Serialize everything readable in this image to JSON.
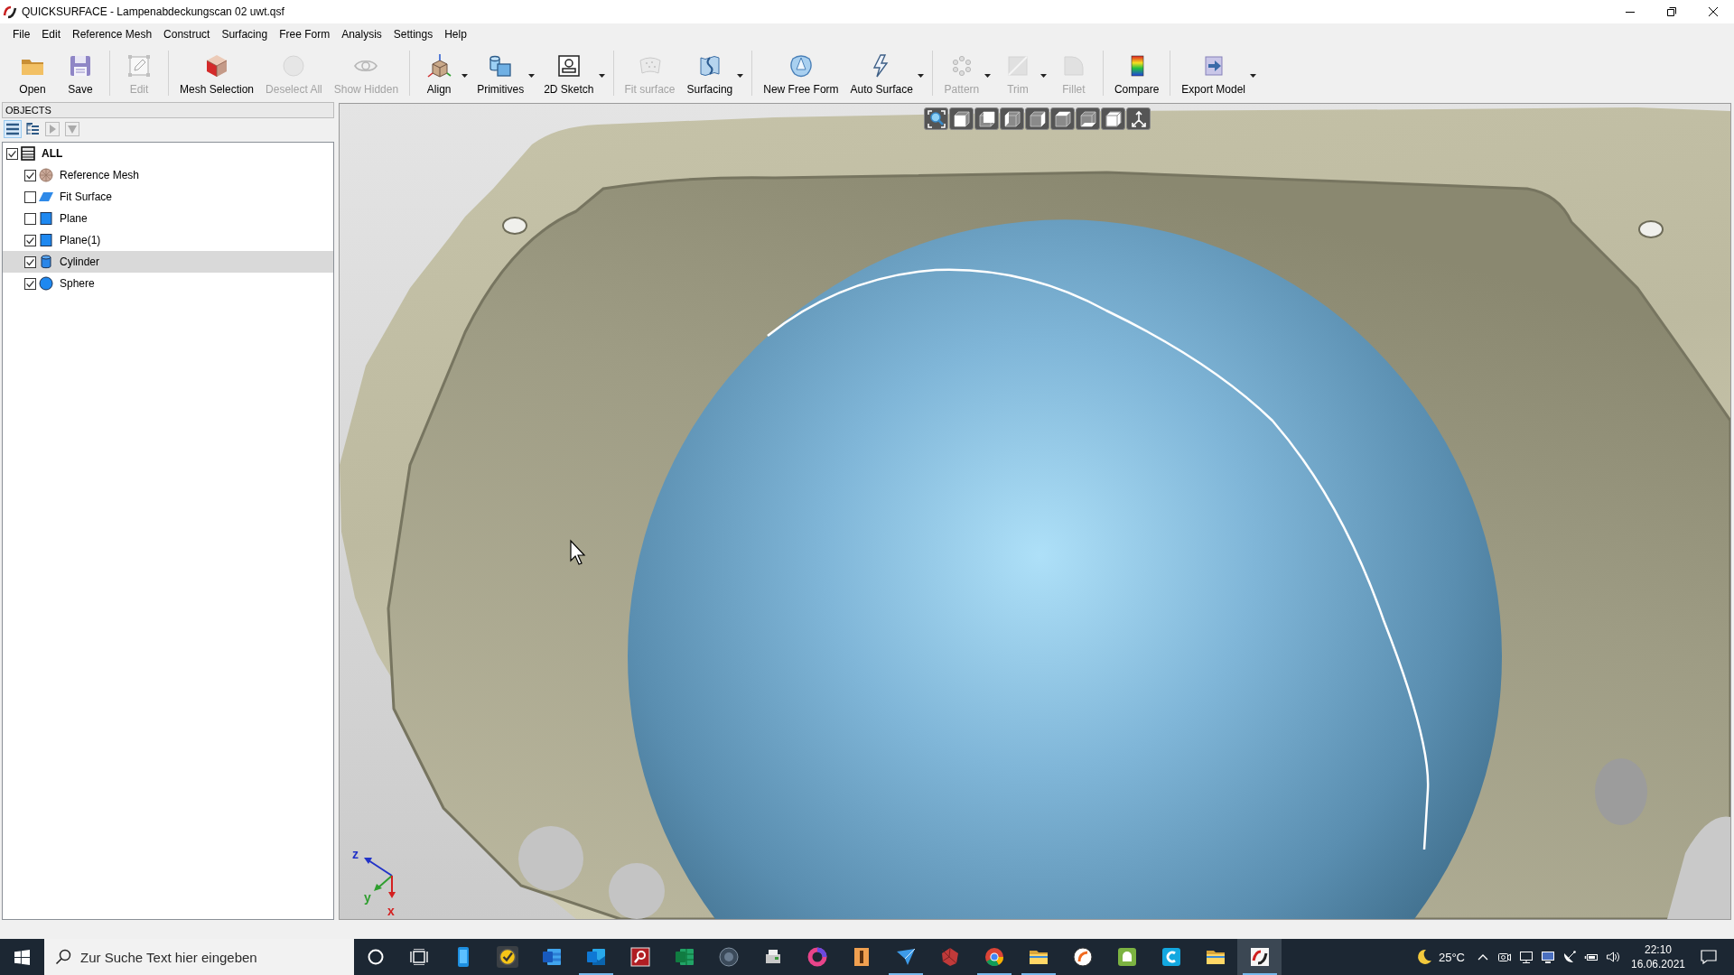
{
  "window": {
    "title": "QUICKSURFACE - Lampenabdeckungscan 02 uwt.qsf"
  },
  "menu": [
    "File",
    "Edit",
    "Reference Mesh",
    "Construct",
    "Surfacing",
    "Free Form",
    "Analysis",
    "Settings",
    "Help"
  ],
  "toolbar": {
    "groups": [
      [
        {
          "label": "Open",
          "disabled": false,
          "dropdown": false
        },
        {
          "label": "Save",
          "disabled": false,
          "dropdown": false
        }
      ],
      [
        {
          "label": "Edit",
          "disabled": true,
          "dropdown": false
        }
      ],
      [
        {
          "label": "Mesh Selection",
          "disabled": false,
          "dropdown": false
        },
        {
          "label": "Deselect All",
          "disabled": true,
          "dropdown": false
        },
        {
          "label": "Show Hidden",
          "disabled": true,
          "dropdown": false
        }
      ],
      [
        {
          "label": "Align",
          "disabled": false,
          "dropdown": true
        },
        {
          "label": "Primitives",
          "disabled": false,
          "dropdown": true
        },
        {
          "label": "2D Sketch",
          "disabled": false,
          "dropdown": true
        }
      ],
      [
        {
          "label": "Fit surface",
          "disabled": true,
          "dropdown": false
        },
        {
          "label": "Surfacing",
          "disabled": false,
          "dropdown": true
        }
      ],
      [
        {
          "label": "New Free Form",
          "disabled": false,
          "dropdown": false
        },
        {
          "label": "Auto Surface",
          "disabled": false,
          "dropdown": true
        }
      ],
      [
        {
          "label": "Pattern",
          "disabled": true,
          "dropdown": true
        },
        {
          "label": "Trim",
          "disabled": true,
          "dropdown": true
        },
        {
          "label": "Fillet",
          "disabled": true,
          "dropdown": false
        }
      ],
      [
        {
          "label": "Compare",
          "disabled": false,
          "dropdown": false
        }
      ],
      [
        {
          "label": "Export Model",
          "disabled": false,
          "dropdown": true
        }
      ]
    ]
  },
  "objects_panel": {
    "title": "OBJECTS",
    "view_buttons": [
      {
        "selected": true,
        "disabled": false
      },
      {
        "selected": false,
        "disabled": false
      },
      {
        "selected": false,
        "disabled": true
      },
      {
        "selected": false,
        "disabled": true
      }
    ],
    "tree": [
      {
        "label": "ALL",
        "kind": "group",
        "checked": true,
        "selected": false,
        "children": [
          {
            "label": "Reference Mesh",
            "kind": "mesh",
            "checked": true,
            "selected": false
          },
          {
            "label": "Fit Surface",
            "kind": "surface",
            "checked": false,
            "selected": false
          },
          {
            "label": "Plane",
            "kind": "plane",
            "checked": false,
            "selected": false
          },
          {
            "label": "Plane(1)",
            "kind": "plane",
            "checked": true,
            "selected": false
          },
          {
            "label": "Cylinder",
            "kind": "cylinder",
            "checked": true,
            "selected": true
          },
          {
            "label": "Sphere",
            "kind": "sphere",
            "checked": true,
            "selected": false
          }
        ]
      }
    ]
  },
  "viewport": {
    "axis_labels": [
      {
        "label": "z",
        "color": "#2233c8"
      },
      {
        "label": "y",
        "color": "#2f9e2f"
      },
      {
        "label": "x",
        "color": "#d42020"
      }
    ]
  },
  "taskbar": {
    "search": {
      "placeholder": "Zur Suche Text hier eingeben"
    },
    "apps": [
      {
        "active": false,
        "selected": false
      },
      {
        "active": false,
        "selected": false
      },
      {
        "active": false,
        "selected": false
      },
      {
        "active": true,
        "selected": false
      },
      {
        "active": false,
        "selected": false
      },
      {
        "active": false,
        "selected": false
      },
      {
        "active": false,
        "selected": false
      },
      {
        "active": false,
        "selected": false
      },
      {
        "active": false,
        "selected": false
      },
      {
        "active": false,
        "selected": false
      },
      {
        "active": true,
        "selected": false
      },
      {
        "active": false,
        "selected": false
      },
      {
        "active": true,
        "selected": false
      },
      {
        "active": true,
        "selected": false
      },
      {
        "active": false,
        "selected": false
      },
      {
        "active": false,
        "selected": false
      },
      {
        "active": false,
        "selected": false
      },
      {
        "active": false,
        "selected": false
      },
      {
        "active": true,
        "selected": true
      }
    ],
    "weather": "25°C",
    "time": "22:10",
    "date": "16.06.2021"
  }
}
